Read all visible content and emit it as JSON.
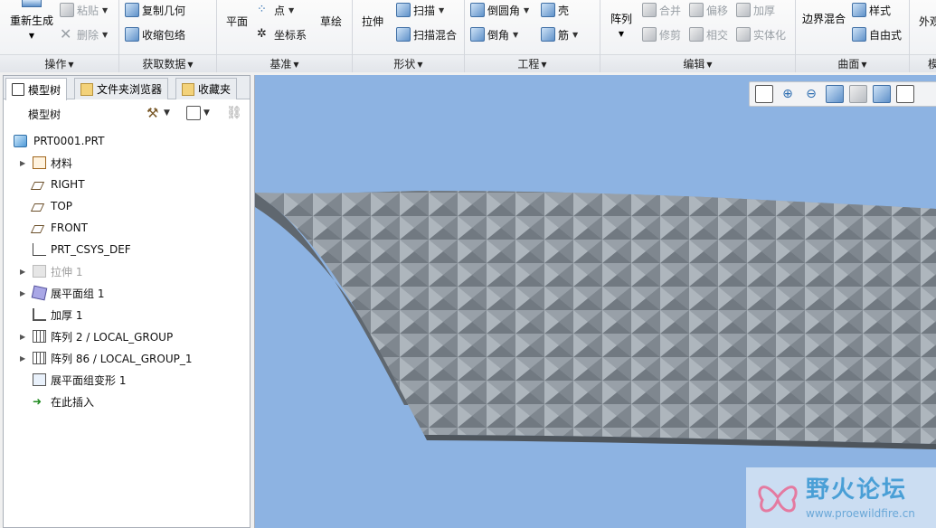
{
  "ribbon": {
    "groups": [
      {
        "name": "operations",
        "caption": "操作"
      },
      {
        "name": "get-data",
        "caption": "获取数据"
      },
      {
        "name": "datum",
        "caption": "基准"
      },
      {
        "name": "shapes",
        "caption": "形状"
      },
      {
        "name": "engineering",
        "caption": "工程"
      },
      {
        "name": "editing",
        "caption": "编辑"
      },
      {
        "name": "surfaces",
        "caption": "曲面"
      },
      {
        "name": "more",
        "caption": "模"
      }
    ],
    "regenerate": "重新生成",
    "paste": "粘贴",
    "delete": "删除",
    "copy_geometry": "复制几何",
    "shrinkwrap": "收缩包络",
    "plane": "平面",
    "point": "点",
    "csys": "坐标系",
    "sketch": "草绘",
    "extrude": "拉伸",
    "sweep": "扫描",
    "swept_blend": "扫描混合",
    "round": "倒圆角",
    "chamfer": "倒角",
    "shell": "壳",
    "rib": "筋",
    "pattern": "阵列",
    "merge": "合并",
    "trim": "修剪",
    "offset": "偏移",
    "intersect": "相交",
    "thicken": "加厚",
    "solidify": "实体化",
    "boundary_blend": "边界混合",
    "style": "样式",
    "freestyle": "自由式",
    "appearance": "外观"
  },
  "left_panel": {
    "tabs": [
      "模型树",
      "文件夹浏览器",
      "收藏夹"
    ],
    "title": "模型树",
    "tree": [
      {
        "label": "PRT0001.PRT",
        "icon": "part-icon",
        "expandable": false,
        "root": true
      },
      {
        "label": "材料",
        "icon": "material-icon",
        "expandable": true
      },
      {
        "label": "RIGHT",
        "icon": "datum-plane-icon",
        "expandable": false
      },
      {
        "label": "TOP",
        "icon": "datum-plane-icon",
        "expandable": false
      },
      {
        "label": "FRONT",
        "icon": "datum-plane-icon",
        "expandable": false
      },
      {
        "label": "PRT_CSYS_DEF",
        "icon": "csys-icon",
        "expandable": false
      },
      {
        "label": "拉伸 1",
        "icon": "extrude-icon",
        "expandable": true,
        "suppressed": true
      },
      {
        "label": "展平面组 1",
        "icon": "flatten-quilt-icon",
        "expandable": true
      },
      {
        "label": "加厚 1",
        "icon": "thicken-icon",
        "expandable": false
      },
      {
        "label": "阵列 2 / LOCAL_GROUP",
        "icon": "pattern-icon",
        "expandable": true
      },
      {
        "label": "阵列 86 / LOCAL_GROUP_1",
        "icon": "pattern-icon",
        "expandable": true
      },
      {
        "label": "展平面组变形 1",
        "icon": "flatten-deform-icon",
        "expandable": false
      },
      {
        "label": "在此插入",
        "icon": "insert-here-icon",
        "expandable": false
      }
    ]
  },
  "viewport": {
    "background": "#8db3e2",
    "model_color": "#8d969e",
    "watermark_title": "野火论坛",
    "watermark_url": "www.proewildfire.cn"
  }
}
